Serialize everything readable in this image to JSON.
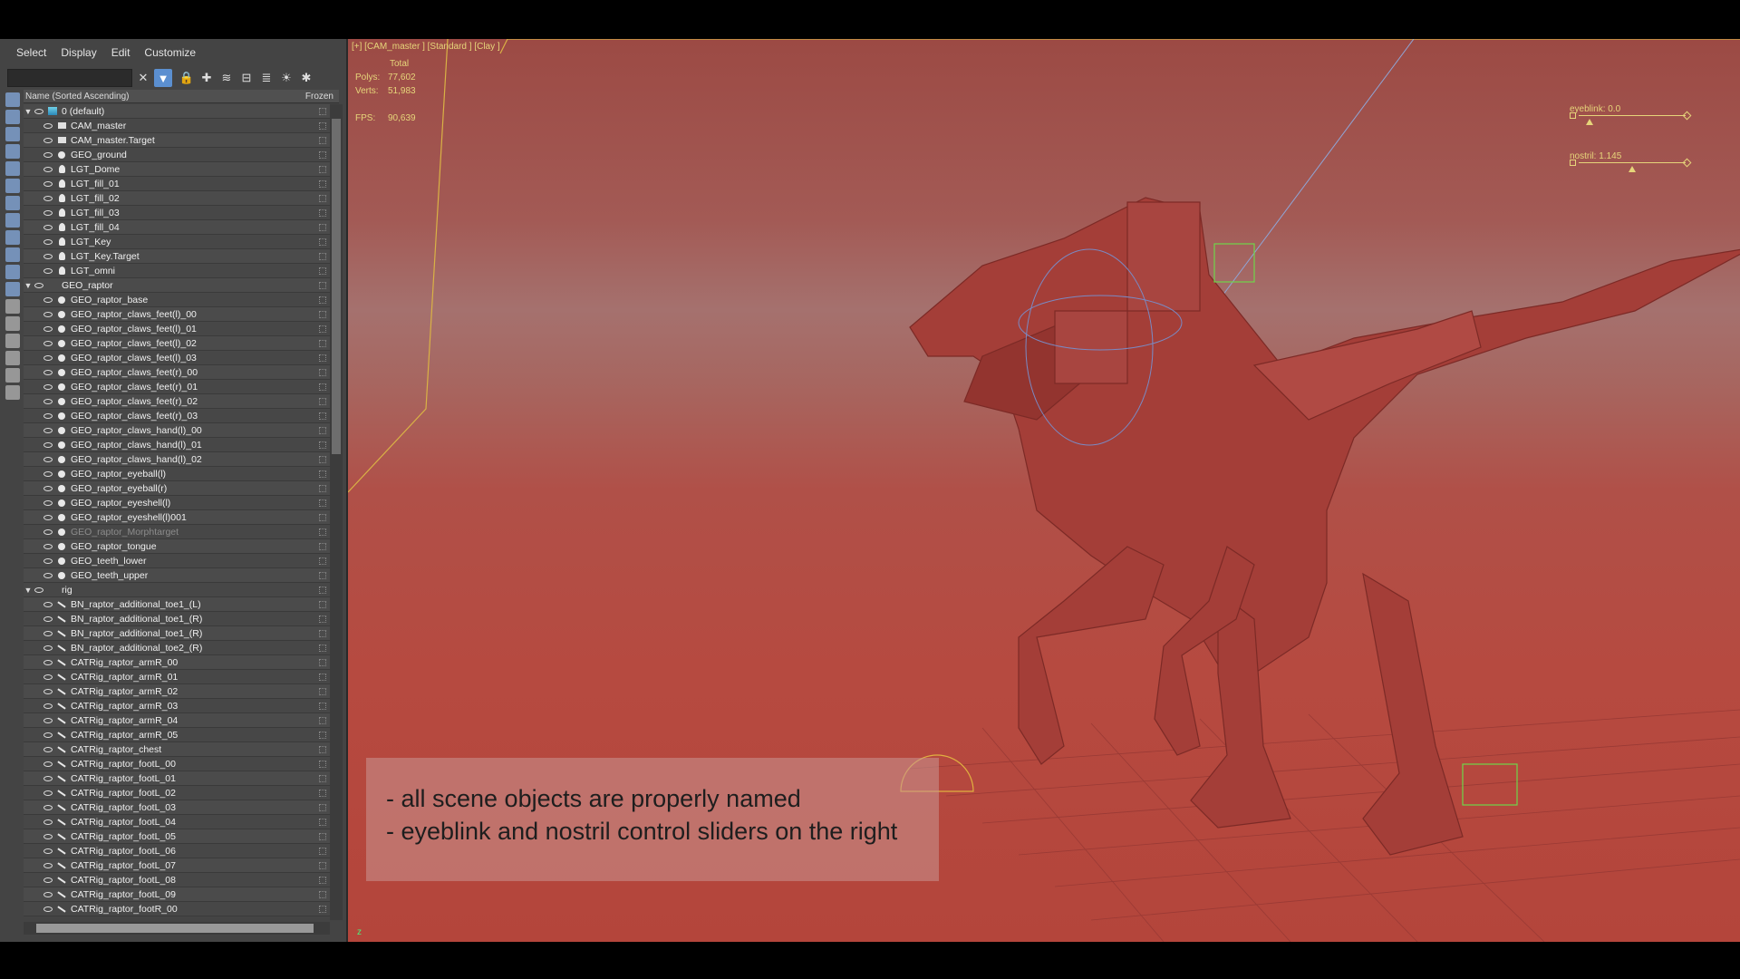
{
  "menu": [
    "Select",
    "Display",
    "Edit",
    "Customize"
  ],
  "header": {
    "name": "Name (Sorted Ascending)",
    "frozen": "Frozen"
  },
  "rows": [
    {
      "label": "0 (default)",
      "level": 0,
      "icon": "layer",
      "expand": true
    },
    {
      "label": "CAM_master",
      "level": 1,
      "icon": "cam"
    },
    {
      "label": "CAM_master.Target",
      "level": 1,
      "icon": "cam"
    },
    {
      "label": "GEO_ground",
      "level": 1,
      "icon": "geo"
    },
    {
      "label": "LGT_Dome",
      "level": 1,
      "icon": "light"
    },
    {
      "label": "LGT_fill_01",
      "level": 1,
      "icon": "light"
    },
    {
      "label": "LGT_fill_02",
      "level": 1,
      "icon": "light"
    },
    {
      "label": "LGT_fill_03",
      "level": 1,
      "icon": "light"
    },
    {
      "label": "LGT_fill_04",
      "level": 1,
      "icon": "light"
    },
    {
      "label": "LGT_Key",
      "level": 1,
      "icon": "light"
    },
    {
      "label": "LGT_Key.Target",
      "level": 1,
      "icon": "light"
    },
    {
      "label": "LGT_omni",
      "level": 1,
      "icon": "light"
    },
    {
      "label": "GEO_raptor",
      "level": 0,
      "icon": "none",
      "expand": true
    },
    {
      "label": "GEO_raptor_base",
      "level": 1,
      "icon": "geo"
    },
    {
      "label": "GEO_raptor_claws_feet(l)_00",
      "level": 1,
      "icon": "geo"
    },
    {
      "label": "GEO_raptor_claws_feet(l)_01",
      "level": 1,
      "icon": "geo"
    },
    {
      "label": "GEO_raptor_claws_feet(l)_02",
      "level": 1,
      "icon": "geo"
    },
    {
      "label": "GEO_raptor_claws_feet(l)_03",
      "level": 1,
      "icon": "geo"
    },
    {
      "label": "GEO_raptor_claws_feet(r)_00",
      "level": 1,
      "icon": "geo"
    },
    {
      "label": "GEO_raptor_claws_feet(r)_01",
      "level": 1,
      "icon": "geo"
    },
    {
      "label": "GEO_raptor_claws_feet(r)_02",
      "level": 1,
      "icon": "geo"
    },
    {
      "label": "GEO_raptor_claws_feet(r)_03",
      "level": 1,
      "icon": "geo"
    },
    {
      "label": "GEO_raptor_claws_hand(l)_00",
      "level": 1,
      "icon": "geo"
    },
    {
      "label": "GEO_raptor_claws_hand(l)_01",
      "level": 1,
      "icon": "geo"
    },
    {
      "label": "GEO_raptor_claws_hand(l)_02",
      "level": 1,
      "icon": "geo"
    },
    {
      "label": "GEO_raptor_eyeball(l)",
      "level": 1,
      "icon": "geo"
    },
    {
      "label": "GEO_raptor_eyeball(r)",
      "level": 1,
      "icon": "geo"
    },
    {
      "label": "GEO_raptor_eyeshell(l)",
      "level": 1,
      "icon": "geo"
    },
    {
      "label": "GEO_raptor_eyeshell(l)001",
      "level": 1,
      "icon": "geo"
    },
    {
      "label": "GEO_raptor_Morphtarget",
      "level": 1,
      "icon": "geo",
      "dim": true
    },
    {
      "label": "GEO_raptor_tongue",
      "level": 1,
      "icon": "geo"
    },
    {
      "label": "GEO_teeth_lower",
      "level": 1,
      "icon": "geo"
    },
    {
      "label": "GEO_teeth_upper",
      "level": 1,
      "icon": "geo"
    },
    {
      "label": "rig",
      "level": 0,
      "icon": "none",
      "expand": true
    },
    {
      "label": "BN_raptor_additional_toe1_(L)",
      "level": 1,
      "icon": "bone"
    },
    {
      "label": "BN_raptor_additional_toe1_(R)",
      "level": 1,
      "icon": "bone"
    },
    {
      "label": "BN_raptor_additional_toe1_(R)",
      "level": 1,
      "icon": "bone"
    },
    {
      "label": "BN_raptor_additional_toe2_(R)",
      "level": 1,
      "icon": "bone"
    },
    {
      "label": "CATRig_raptor_armR_00",
      "level": 1,
      "icon": "bone"
    },
    {
      "label": "CATRig_raptor_armR_01",
      "level": 1,
      "icon": "bone"
    },
    {
      "label": "CATRig_raptor_armR_02",
      "level": 1,
      "icon": "bone"
    },
    {
      "label": "CATRig_raptor_armR_03",
      "level": 1,
      "icon": "bone"
    },
    {
      "label": "CATRig_raptor_armR_04",
      "level": 1,
      "icon": "bone"
    },
    {
      "label": "CATRig_raptor_armR_05",
      "level": 1,
      "icon": "bone"
    },
    {
      "label": "CATRig_raptor_chest",
      "level": 1,
      "icon": "bone"
    },
    {
      "label": "CATRig_raptor_footL_00",
      "level": 1,
      "icon": "bone"
    },
    {
      "label": "CATRig_raptor_footL_01",
      "level": 1,
      "icon": "bone"
    },
    {
      "label": "CATRig_raptor_footL_02",
      "level": 1,
      "icon": "bone"
    },
    {
      "label": "CATRig_raptor_footL_03",
      "level": 1,
      "icon": "bone"
    },
    {
      "label": "CATRig_raptor_footL_04",
      "level": 1,
      "icon": "bone"
    },
    {
      "label": "CATRig_raptor_footL_05",
      "level": 1,
      "icon": "bone"
    },
    {
      "label": "CATRig_raptor_footL_06",
      "level": 1,
      "icon": "bone"
    },
    {
      "label": "CATRig_raptor_footL_07",
      "level": 1,
      "icon": "bone"
    },
    {
      "label": "CATRig_raptor_footL_08",
      "level": 1,
      "icon": "bone"
    },
    {
      "label": "CATRig_raptor_footL_09",
      "level": 1,
      "icon": "bone"
    },
    {
      "label": "CATRig_raptor_footR_00",
      "level": 1,
      "icon": "bone"
    }
  ],
  "viewport": {
    "label": "[+] [CAM_master ] [Standard ] [Clay ]",
    "stats_total": "Total",
    "polys_label": "Polys:",
    "polys_value": "77,602",
    "verts_label": "Verts:",
    "verts_value": "51,983",
    "fps_label": "FPS:",
    "fps_value": "90,639"
  },
  "sliders": {
    "eyeblink": {
      "label": "eyeblink: 0.0",
      "value": 0.0
    },
    "nostril": {
      "label": "nostril: 1.145",
      "value": 1.145
    }
  },
  "caption": {
    "line1": "- all scene objects are properly named",
    "line2": "- eyeblink and nostril control sliders on the right"
  },
  "colors": {
    "viewport_bg": "#b04a42",
    "hud_text": "#e6d57a",
    "panel_bg": "#444444"
  }
}
